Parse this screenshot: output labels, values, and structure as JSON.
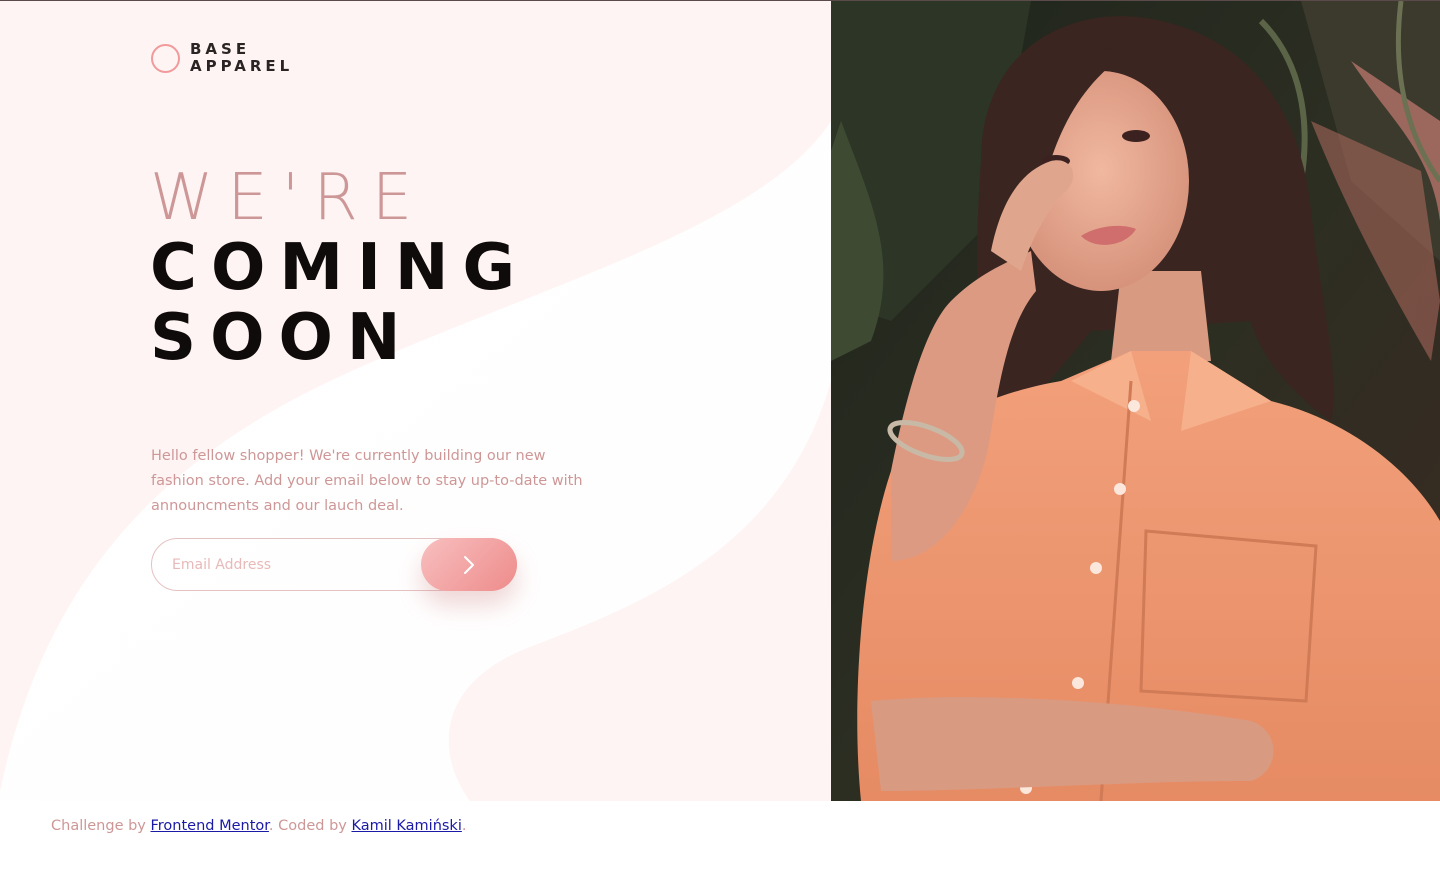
{
  "brand": {
    "line1": "BASE",
    "line2": "APPAREL",
    "accent_color": "#f19a9b"
  },
  "hero": {
    "headline_light": "WE'RE",
    "headline_dark_1": "COMING",
    "headline_dark_2": "SOON",
    "intro": "Hello fellow shopper! We're currently building our new fashion store. Add your email below to stay up-to-date with announcments and our lauch deal."
  },
  "signup": {
    "email_placeholder": "Email Address",
    "submit_icon": "chevron-right-icon"
  },
  "photo": {
    "subject": "woman in orange shirt"
  },
  "footer": {
    "prefix": "Challenge by ",
    "mentor_link": "Frontend Mentor",
    "middle": ". Coded by ",
    "author_link": "Kamil Kamiński",
    "suffix": "."
  },
  "colors": {
    "pink_text": "#ce9797",
    "dark_text": "#0f0b0b",
    "button_start": "#f8bfbf",
    "button_end": "#ee8b8b",
    "link": "#1a1aa6"
  }
}
